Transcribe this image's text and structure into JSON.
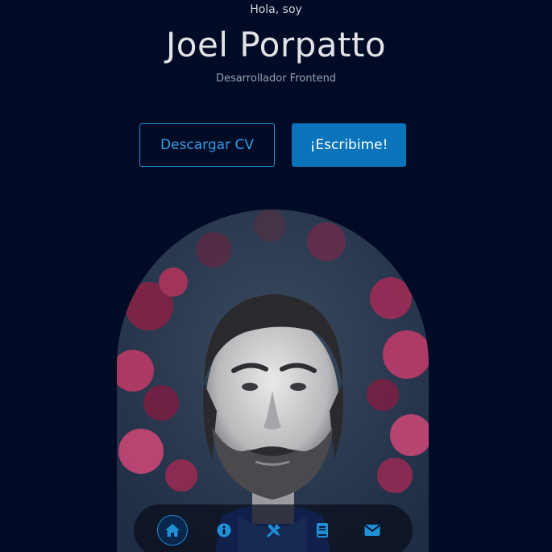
{
  "hero": {
    "greeting": "Hola, soy",
    "name": "Joel Porpatto",
    "role": "Desarrollador Frontend"
  },
  "actions": {
    "download_cv_label": "Descargar CV",
    "contact_label": "¡Escribime!"
  },
  "nav": {
    "items": [
      {
        "icon": "home-icon",
        "active": true
      },
      {
        "icon": "info-icon",
        "active": false
      },
      {
        "icon": "tools-icon",
        "active": false
      },
      {
        "icon": "book-icon",
        "active": false
      },
      {
        "icon": "envelope-icon",
        "active": false
      }
    ]
  },
  "colors": {
    "background": "#020b25",
    "accent": "#1f8fd6",
    "accent_solid": "#0a74ba"
  }
}
